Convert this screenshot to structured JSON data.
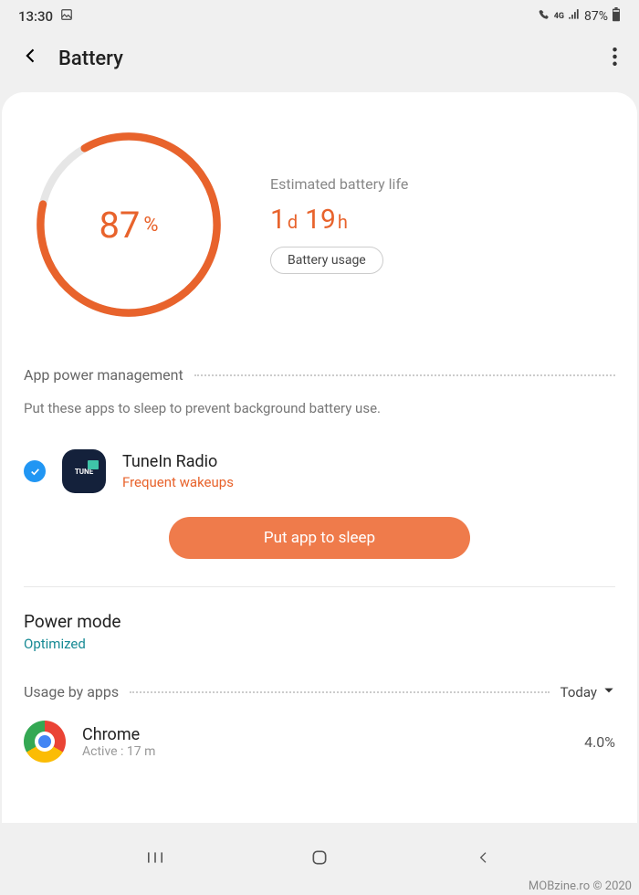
{
  "status": {
    "time": "13:30",
    "network_label": "4G",
    "battery_pct": "87%"
  },
  "header": {
    "title": "Battery"
  },
  "battery": {
    "percent_value": "87",
    "percent_unit": "%",
    "estimate_label": "Estimated battery life",
    "time_days": "1",
    "time_days_unit": "d",
    "time_hours": "19",
    "time_hours_unit": "h",
    "usage_button": "Battery usage",
    "ring_fill_pct": 87
  },
  "power_mgmt": {
    "section_title": "App power management",
    "subtitle": "Put these apps to sleep to prevent background battery use.",
    "app_name": "TuneIn Radio",
    "app_warning": "Frequent wakeups",
    "app_icon_text": "TUNE",
    "sleep_button": "Put app to sleep"
  },
  "power_mode": {
    "title": "Power mode",
    "value": "Optimized"
  },
  "usage": {
    "section_title": "Usage by apps",
    "dropdown": "Today",
    "apps": [
      {
        "name": "Chrome",
        "sub": "Active : 17 m",
        "pct": "4.0%"
      }
    ]
  },
  "watermark": "MOBzine.ro © 2020"
}
